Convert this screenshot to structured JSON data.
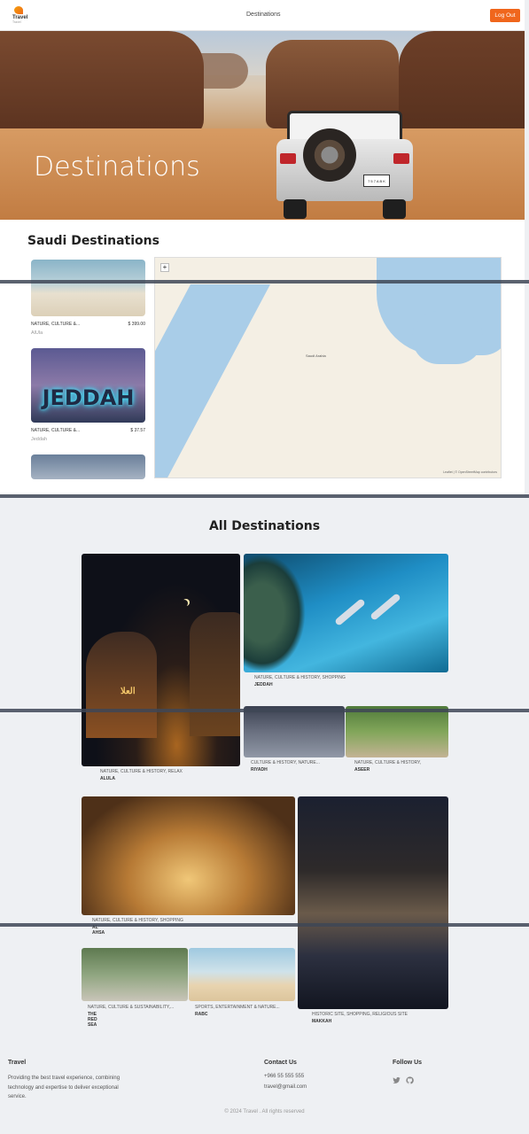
{
  "nav": {
    "logo_word": "Travel",
    "logo_sub": "Travel",
    "link": "Destinations",
    "logout": "Log Out"
  },
  "hero": {
    "title": "Destinations",
    "plate": "7 5 7 A B K"
  },
  "saudi": {
    "heading": "Saudi Destinations",
    "cards": [
      {
        "tags": "NATURE, CULTURE &...",
        "price": "$ 399.00",
        "place": "AlUla"
      },
      {
        "tags": "NATURE, CULTURE &...",
        "price": "$ 37.57",
        "place": "Jeddah",
        "sign": "JEDDAH"
      }
    ],
    "map": {
      "zoom_in": "+",
      "capital": "Saudi Arabia",
      "attribution": "Leaflet | © OpenStreetMap contributors"
    }
  },
  "all": {
    "heading": "All Destinations",
    "items": [
      {
        "tags": "NATURE, CULTURE & HISTORY, RELAX",
        "name": "ALULA",
        "sign": "العلا"
      },
      {
        "tags": "NATURE, CULTURE & HISTORY, SHOPPING",
        "name": "JEDDAH"
      },
      {
        "tags": "CULTURE & HISTORY, NATURE...",
        "name": "RIYADH"
      },
      {
        "tags": "NATURE, CULTURE & HISTORY,",
        "name": "ASEER"
      },
      {
        "tags": "NATURE, CULTURE & HISTORY, SHOPPING",
        "name": "AL AHSA"
      },
      {
        "tags": "HISTORIC SITE, SHOPPING, RELIGIOUS SITE",
        "name": "MAKKAH"
      },
      {
        "tags": "NATURE, CULTURE & SUSTAINABILITY,...",
        "name": "THE RED SEA"
      },
      {
        "tags": "SPORTS, ENTERTAINMENT & NATURE...",
        "name": "RABC"
      }
    ]
  },
  "footer": {
    "brand": "Travel",
    "description": "Providing the best travel experience, combining technology and expertise to deliver exceptional service.",
    "contact_heading": "Contact Us",
    "phone": "+966 55 555 555",
    "email": "travel@gmail.com",
    "follow_heading": "Follow Us",
    "copyright": "© 2024 Travel . All rights reserved"
  },
  "colors": {
    "accent": "#f0661c",
    "page_bg": "#eef0f3"
  },
  "icons": [
    "twitter-icon",
    "github-icon"
  ]
}
